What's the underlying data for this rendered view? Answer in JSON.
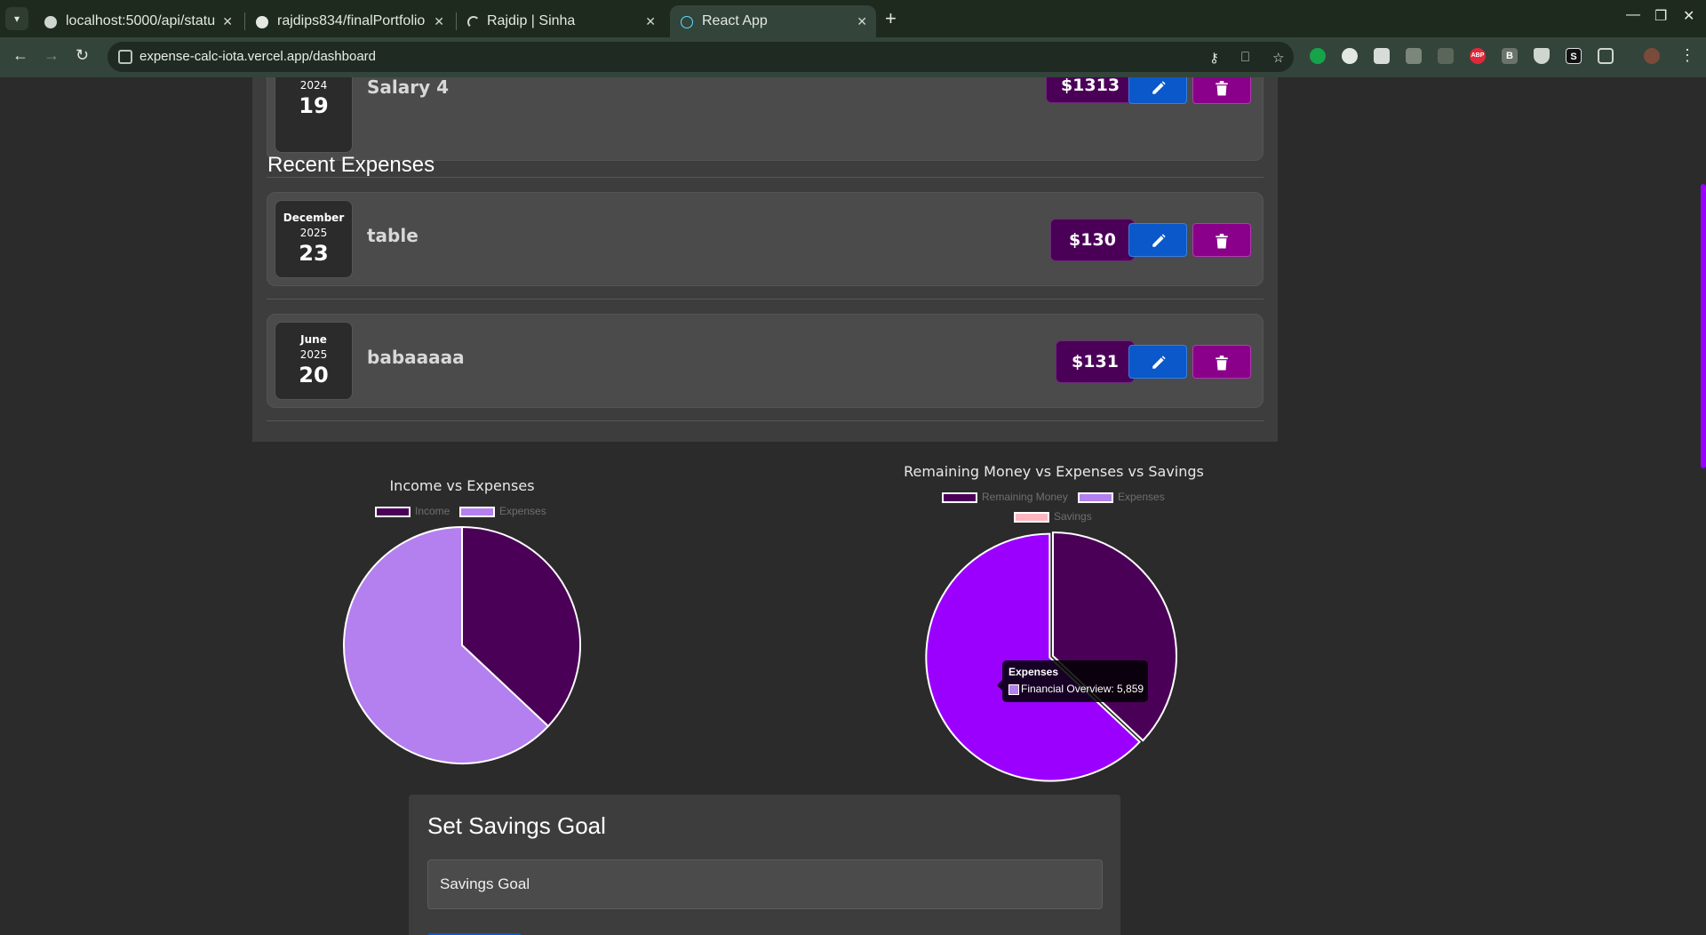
{
  "browser": {
    "tabs": [
      {
        "title": "localhost:5000/api/statu",
        "active": false
      },
      {
        "title": "rajdips834/finalPortfolio",
        "active": false
      },
      {
        "title": "Rajdip | Sinha",
        "active": false
      },
      {
        "title": "React App",
        "active": true
      }
    ],
    "url": "expense-calc-iota.vercel.app/dashboard",
    "extensions": [
      "grammarly-icon",
      "mouse-icon",
      "tab-icon",
      "folder-icon",
      "copy-icon",
      "adblock-icon",
      "b-extension-icon",
      "shield-extension-icon",
      "s-extension-icon",
      "puzzle-icon"
    ],
    "extension_labels": {
      "adblock": "ABP",
      "b": "B",
      "s": "S"
    }
  },
  "income_item": {
    "year": "2024",
    "day": "19",
    "title": "Salary 4",
    "amount": "$1313"
  },
  "recent_expenses": {
    "heading": "Recent Expenses",
    "items": [
      {
        "month": "December",
        "year": "2025",
        "day": "23",
        "title": "table",
        "amount": "$130"
      },
      {
        "month": "June",
        "year": "2025",
        "day": "20",
        "title": "babaaaaa",
        "amount": "$131"
      }
    ]
  },
  "chart_data": [
    {
      "type": "pie",
      "title": "Income vs Expenses",
      "categories": [
        "Income",
        "Expenses"
      ],
      "values": [
        37,
        63
      ],
      "colors": [
        "#4b0058",
        "#b47fee"
      ]
    },
    {
      "type": "pie",
      "title": "Remaining Money vs Expenses vs Savings",
      "categories": [
        "Remaining Money",
        "Expenses",
        "Savings"
      ],
      "values": [
        3441,
        5859,
        0
      ],
      "colors": [
        "#4b0058",
        "#b47fee",
        "#ffb6c1"
      ],
      "highlighted_color": "#9b00ff",
      "tooltip": {
        "title": "Expenses",
        "label": "Financial Overview: 5,859"
      }
    }
  ],
  "savings_goal": {
    "title": "Set Savings Goal",
    "placeholder": "Savings Goal"
  },
  "colors": {
    "amount_badge": "#4b0058",
    "edit_button": "#0a58ca",
    "delete_button": "#8a008a",
    "scroll_thumb": "#9b00ff"
  }
}
